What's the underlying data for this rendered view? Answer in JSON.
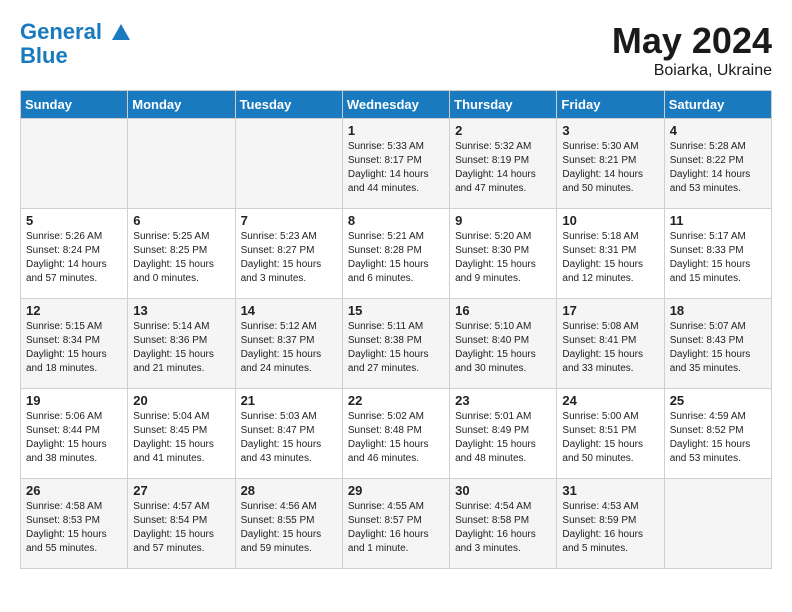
{
  "header": {
    "logo_line1": "General",
    "logo_line2": "Blue",
    "month_year": "May 2024",
    "location": "Boiarka, Ukraine"
  },
  "weekdays": [
    "Sunday",
    "Monday",
    "Tuesday",
    "Wednesday",
    "Thursday",
    "Friday",
    "Saturday"
  ],
  "weeks": [
    [
      {
        "day": "",
        "info": ""
      },
      {
        "day": "",
        "info": ""
      },
      {
        "day": "",
        "info": ""
      },
      {
        "day": "1",
        "info": "Sunrise: 5:33 AM\nSunset: 8:17 PM\nDaylight: 14 hours\nand 44 minutes."
      },
      {
        "day": "2",
        "info": "Sunrise: 5:32 AM\nSunset: 8:19 PM\nDaylight: 14 hours\nand 47 minutes."
      },
      {
        "day": "3",
        "info": "Sunrise: 5:30 AM\nSunset: 8:21 PM\nDaylight: 14 hours\nand 50 minutes."
      },
      {
        "day": "4",
        "info": "Sunrise: 5:28 AM\nSunset: 8:22 PM\nDaylight: 14 hours\nand 53 minutes."
      }
    ],
    [
      {
        "day": "5",
        "info": "Sunrise: 5:26 AM\nSunset: 8:24 PM\nDaylight: 14 hours\nand 57 minutes."
      },
      {
        "day": "6",
        "info": "Sunrise: 5:25 AM\nSunset: 8:25 PM\nDaylight: 15 hours\nand 0 minutes."
      },
      {
        "day": "7",
        "info": "Sunrise: 5:23 AM\nSunset: 8:27 PM\nDaylight: 15 hours\nand 3 minutes."
      },
      {
        "day": "8",
        "info": "Sunrise: 5:21 AM\nSunset: 8:28 PM\nDaylight: 15 hours\nand 6 minutes."
      },
      {
        "day": "9",
        "info": "Sunrise: 5:20 AM\nSunset: 8:30 PM\nDaylight: 15 hours\nand 9 minutes."
      },
      {
        "day": "10",
        "info": "Sunrise: 5:18 AM\nSunset: 8:31 PM\nDaylight: 15 hours\nand 12 minutes."
      },
      {
        "day": "11",
        "info": "Sunrise: 5:17 AM\nSunset: 8:33 PM\nDaylight: 15 hours\nand 15 minutes."
      }
    ],
    [
      {
        "day": "12",
        "info": "Sunrise: 5:15 AM\nSunset: 8:34 PM\nDaylight: 15 hours\nand 18 minutes."
      },
      {
        "day": "13",
        "info": "Sunrise: 5:14 AM\nSunset: 8:36 PM\nDaylight: 15 hours\nand 21 minutes."
      },
      {
        "day": "14",
        "info": "Sunrise: 5:12 AM\nSunset: 8:37 PM\nDaylight: 15 hours\nand 24 minutes."
      },
      {
        "day": "15",
        "info": "Sunrise: 5:11 AM\nSunset: 8:38 PM\nDaylight: 15 hours\nand 27 minutes."
      },
      {
        "day": "16",
        "info": "Sunrise: 5:10 AM\nSunset: 8:40 PM\nDaylight: 15 hours\nand 30 minutes."
      },
      {
        "day": "17",
        "info": "Sunrise: 5:08 AM\nSunset: 8:41 PM\nDaylight: 15 hours\nand 33 minutes."
      },
      {
        "day": "18",
        "info": "Sunrise: 5:07 AM\nSunset: 8:43 PM\nDaylight: 15 hours\nand 35 minutes."
      }
    ],
    [
      {
        "day": "19",
        "info": "Sunrise: 5:06 AM\nSunset: 8:44 PM\nDaylight: 15 hours\nand 38 minutes."
      },
      {
        "day": "20",
        "info": "Sunrise: 5:04 AM\nSunset: 8:45 PM\nDaylight: 15 hours\nand 41 minutes."
      },
      {
        "day": "21",
        "info": "Sunrise: 5:03 AM\nSunset: 8:47 PM\nDaylight: 15 hours\nand 43 minutes."
      },
      {
        "day": "22",
        "info": "Sunrise: 5:02 AM\nSunset: 8:48 PM\nDaylight: 15 hours\nand 46 minutes."
      },
      {
        "day": "23",
        "info": "Sunrise: 5:01 AM\nSunset: 8:49 PM\nDaylight: 15 hours\nand 48 minutes."
      },
      {
        "day": "24",
        "info": "Sunrise: 5:00 AM\nSunset: 8:51 PM\nDaylight: 15 hours\nand 50 minutes."
      },
      {
        "day": "25",
        "info": "Sunrise: 4:59 AM\nSunset: 8:52 PM\nDaylight: 15 hours\nand 53 minutes."
      }
    ],
    [
      {
        "day": "26",
        "info": "Sunrise: 4:58 AM\nSunset: 8:53 PM\nDaylight: 15 hours\nand 55 minutes."
      },
      {
        "day": "27",
        "info": "Sunrise: 4:57 AM\nSunset: 8:54 PM\nDaylight: 15 hours\nand 57 minutes."
      },
      {
        "day": "28",
        "info": "Sunrise: 4:56 AM\nSunset: 8:55 PM\nDaylight: 15 hours\nand 59 minutes."
      },
      {
        "day": "29",
        "info": "Sunrise: 4:55 AM\nSunset: 8:57 PM\nDaylight: 16 hours\nand 1 minute."
      },
      {
        "day": "30",
        "info": "Sunrise: 4:54 AM\nSunset: 8:58 PM\nDaylight: 16 hours\nand 3 minutes."
      },
      {
        "day": "31",
        "info": "Sunrise: 4:53 AM\nSunset: 8:59 PM\nDaylight: 16 hours\nand 5 minutes."
      },
      {
        "day": "",
        "info": ""
      }
    ]
  ]
}
